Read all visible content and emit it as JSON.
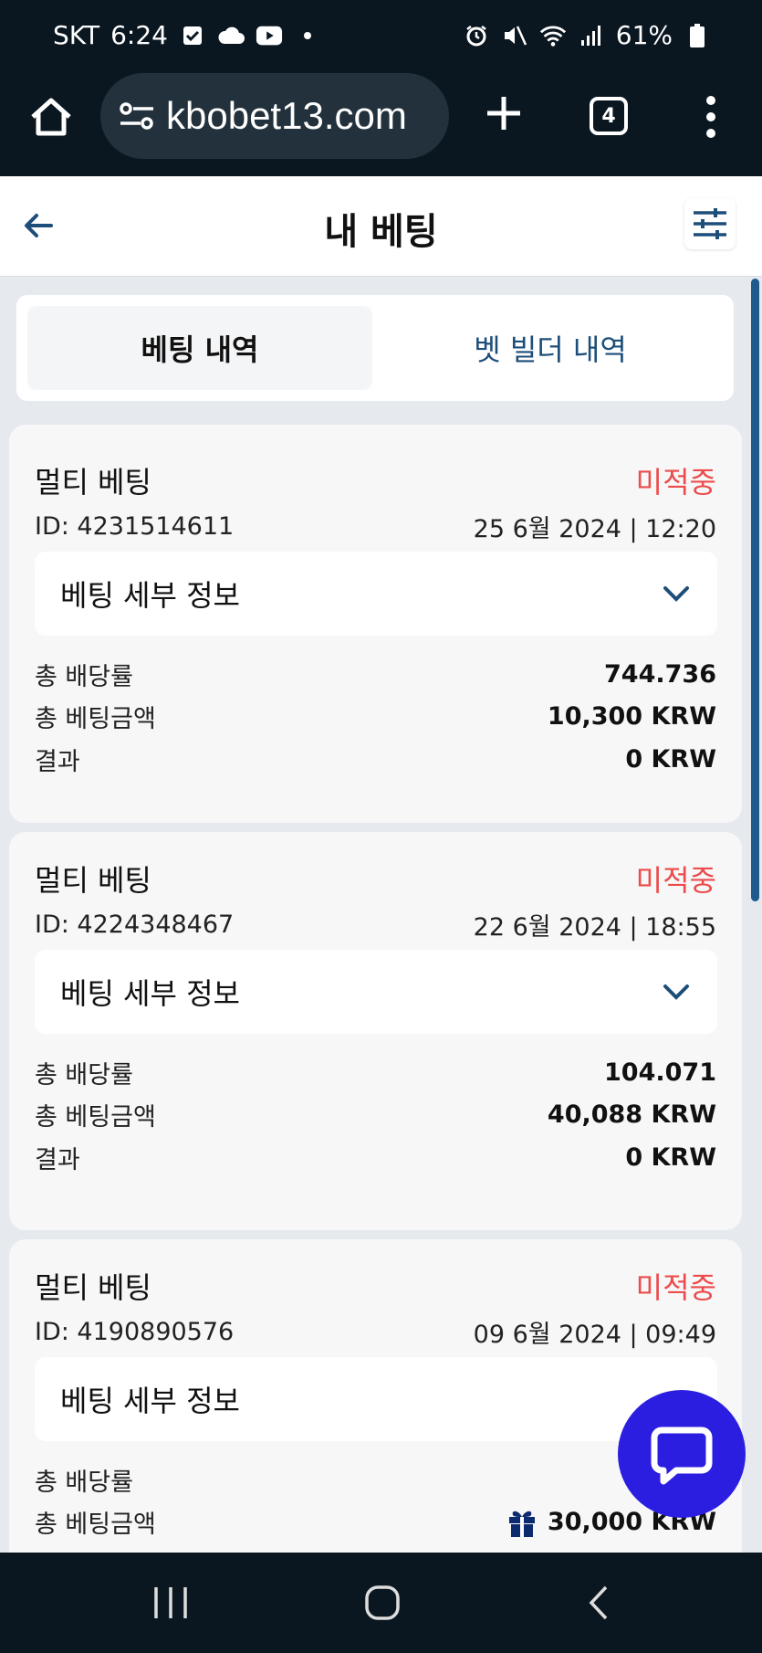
{
  "status_bar": {
    "carrier": "SKT",
    "time": "6:24",
    "battery": "61%"
  },
  "browser": {
    "url": "kbobet13.com",
    "tab_count": "4"
  },
  "page": {
    "title": "내 베팅"
  },
  "tabs": [
    {
      "label": "베팅 내역",
      "active": true
    },
    {
      "label": "벳 빌더 내역",
      "active": false
    }
  ],
  "bets": [
    {
      "type": "멀티 베팅",
      "status": "미적중",
      "id": "ID: 4231514611",
      "date": "25 6월 2024 | 12:20",
      "details_label": "베팅 세부 정보",
      "odds_label": "총 배당률",
      "odds": "744.736",
      "stake_label": "총 베팅금액",
      "stake": "10,300 KRW",
      "result_label": "결과",
      "result": "0 KRW"
    },
    {
      "type": "멀티 베팅",
      "status": "미적중",
      "id": "ID: 4224348467",
      "date": "22 6월 2024 | 18:55",
      "details_label": "베팅 세부 정보",
      "odds_label": "총 배당률",
      "odds": "104.071",
      "stake_label": "총 베팅금액",
      "stake": "40,088 KRW",
      "result_label": "결과",
      "result": "0 KRW"
    },
    {
      "type": "멀티 베팅",
      "status": "미적중",
      "id": "ID: 4190890576",
      "date": "09 6월 2024 | 09:49",
      "details_label": "베팅 세부 정보",
      "odds_label": "총 배당률",
      "odds": "",
      "stake_label": "총 베팅금액",
      "stake": "30,000 KRW",
      "result_label": "",
      "result": ""
    }
  ],
  "colors": {
    "status_red": "#ec4c4c",
    "accent_blue": "#1d4e7a",
    "chat_blue": "#2b1ee0",
    "system_bar": "#0b1720"
  },
  "icons": {
    "home": "home-icon",
    "site_settings": "tune-icon",
    "new_tab": "plus-icon",
    "menu": "more-vertical-icon",
    "back": "arrow-left-icon",
    "filter": "sliders-icon",
    "expand": "chevron-down-icon",
    "gift": "gift-icon",
    "chat": "chat-bubble-icon"
  }
}
